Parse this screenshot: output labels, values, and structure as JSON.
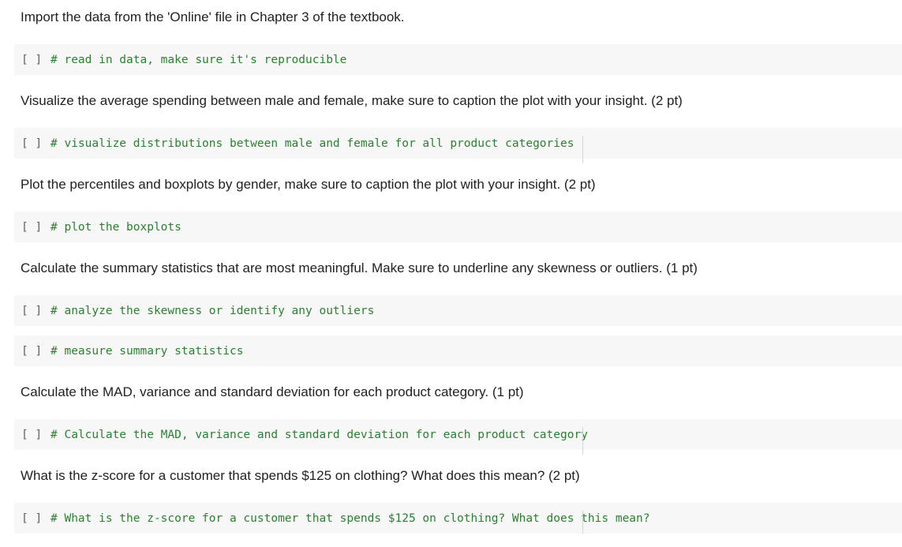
{
  "notebook": {
    "cells": [
      {
        "type": "text",
        "text": "Import the data from the 'Online' file in Chapter 3 of the textbook."
      },
      {
        "type": "code",
        "run_indicator": "[ ]",
        "code": "# read in data, make sure it's reproducible"
      },
      {
        "type": "text",
        "text": "Visualize the average spending between male and female, make sure to caption the plot with your insight. (2 pt)"
      },
      {
        "type": "code",
        "run_indicator": "[ ]",
        "code": "# visualize distributions between male and female for all product categories"
      },
      {
        "type": "text",
        "text": "Plot the percentiles and boxplots by gender, make sure to caption the plot with your insight. (2 pt)"
      },
      {
        "type": "code",
        "run_indicator": "[ ]",
        "code": "# plot the boxplots"
      },
      {
        "type": "text",
        "text": "Calculate the summary statistics that are most meaningful. Make sure to underline any skewness or outliers. (1 pt)"
      },
      {
        "type": "code",
        "run_indicator": "[ ]",
        "code": "# analyze the skewness or identify any outliers"
      },
      {
        "type": "code",
        "run_indicator": "[ ]",
        "code": "# measure summary statistics"
      },
      {
        "type": "text",
        "text": "Calculate the MAD, variance and standard deviation for each product category. (1 pt)"
      },
      {
        "type": "code",
        "run_indicator": "[ ]",
        "code": "# Calculate the MAD, variance and standard deviation for each product category"
      },
      {
        "type": "text",
        "text": "What is the z-score for a customer that spends $125 on clothing? What does this mean? (2 pt)"
      },
      {
        "type": "code",
        "run_indicator": "[ ]",
        "code": "# What is the z-score for a customer that spends $125 on clothing? What does this mean?"
      }
    ]
  },
  "colors": {
    "code_background": "#f7f7f7",
    "comment_green": "#2e7d32",
    "text": "#212121",
    "bracket_gray": "#616161"
  }
}
